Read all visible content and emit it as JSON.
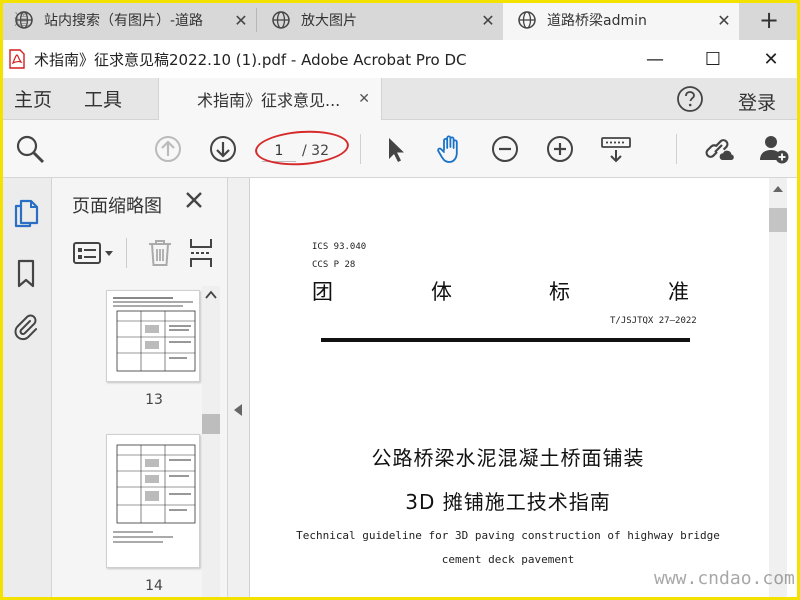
{
  "browser": {
    "watermark_char": "道",
    "tabs": [
      {
        "title": "站内搜索（有图片）-道路",
        "active": false
      },
      {
        "title": "放大图片",
        "active": false
      },
      {
        "title": "道路桥梁admin",
        "active": true
      }
    ],
    "new_tab": "+",
    "close_glyph": "✕"
  },
  "window": {
    "title": "术指南》征求意见稿2022.10 (1).pdf - Adobe Acrobat Pro DC",
    "minimize": "—",
    "maximize": "☐",
    "close": "✕"
  },
  "menu": {
    "home": "主页",
    "tools": "工具",
    "doc_tab": "术指南》征求意见...",
    "doc_tab_close": "✕",
    "sign_in": "登录"
  },
  "toolbar": {
    "current_page": "1",
    "total_pages": "/ 32"
  },
  "thumbnails": {
    "title": "页面缩略图",
    "pages": [
      {
        "number": "13"
      },
      {
        "number": "14"
      }
    ]
  },
  "document": {
    "ics": "ICS 93.040",
    "ccs": "CCS P 28",
    "standard_chars": [
      "团",
      "体",
      "标",
      "准"
    ],
    "code": "T/JSJTQX 27—2022",
    "title_cn_1": "公路桥梁水泥混凝土桥面铺装",
    "title_cn_2": "3D 摊铺施工技术指南",
    "title_en_1": "Technical guideline for 3D paving construction of highway bridge",
    "title_en_2": "cement deck pavement"
  },
  "site_watermark": "www.cndao.com",
  "colors": {
    "frame": "#f3e100",
    "annotation": "#d62a2a",
    "hand_tool": "#1a73c8",
    "sidebar_icon": "#2a6fc4"
  }
}
